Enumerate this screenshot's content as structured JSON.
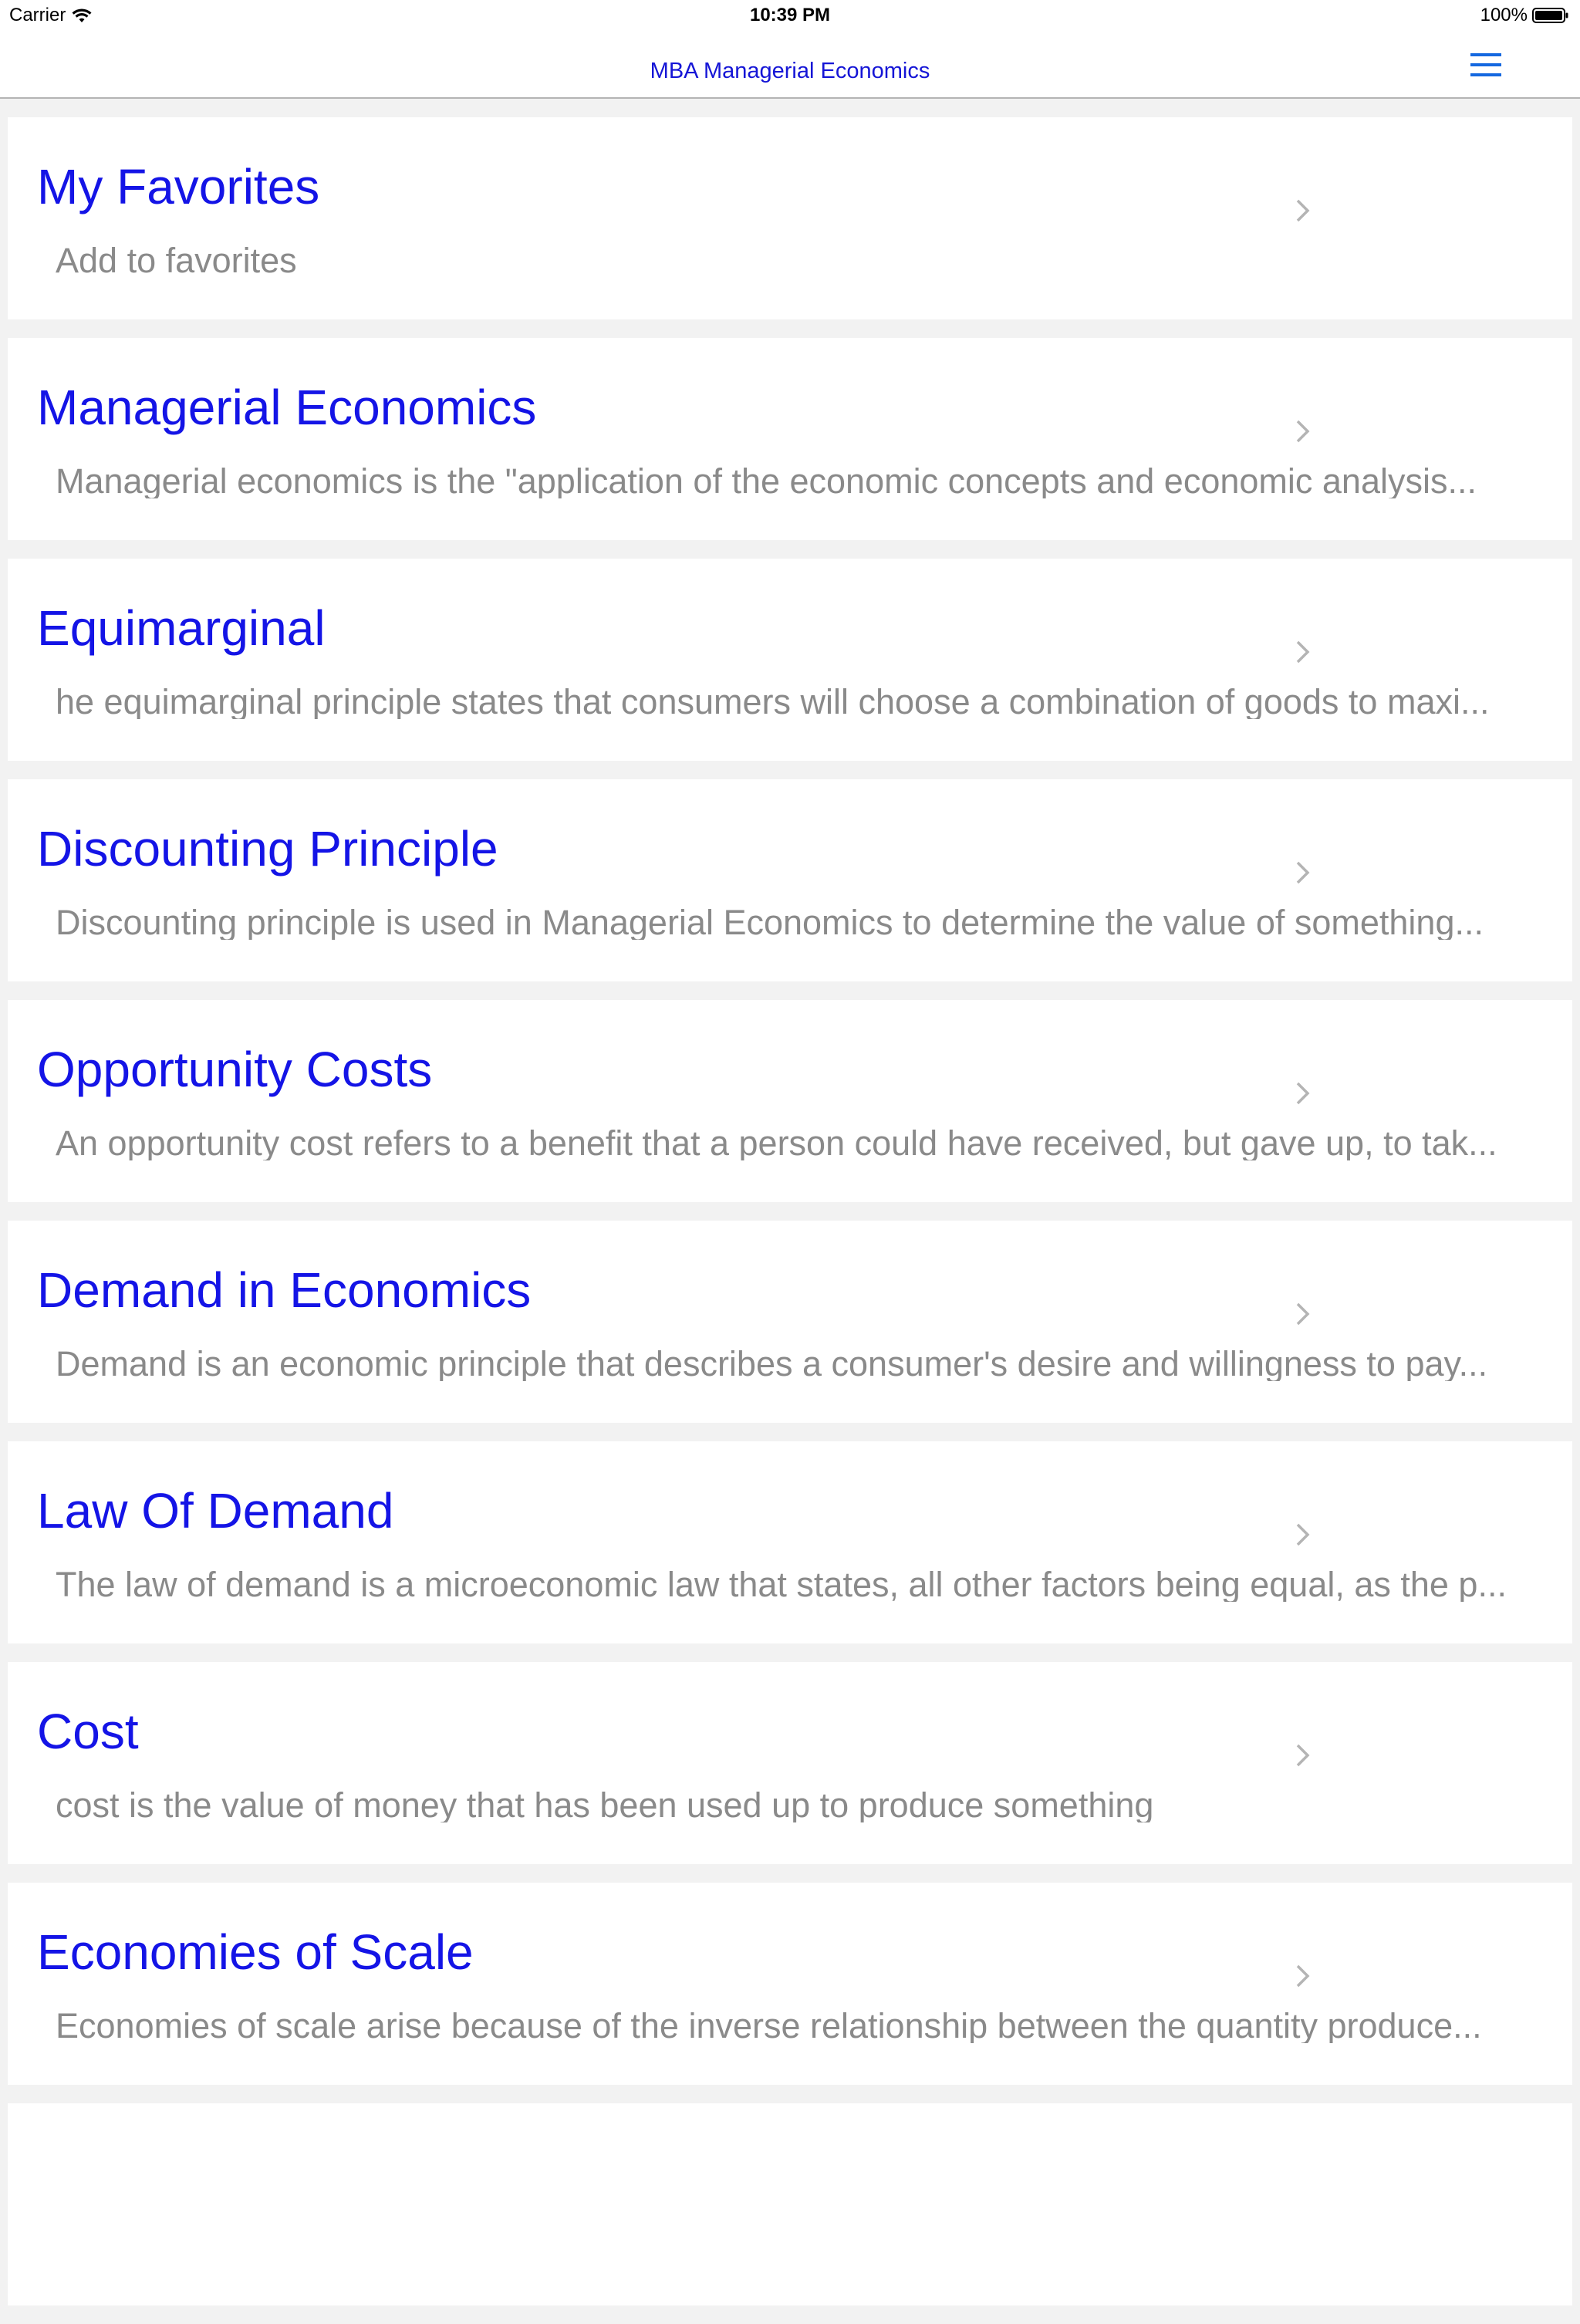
{
  "status_bar": {
    "carrier": "Carrier",
    "time": "10:39 PM",
    "battery": "100%"
  },
  "nav": {
    "title": "MBA Managerial Economics",
    "menu_icon": "hamburger-menu-icon",
    "accent_color": "#1414e6"
  },
  "items": [
    {
      "title": "My Favorites",
      "subtitle": "Add to favorites"
    },
    {
      "title": "Managerial Economics",
      "subtitle": "Managerial economics is the \"application of the economic concepts and economic analysis..."
    },
    {
      "title": "Equimarginal",
      "subtitle": "he equimarginal principle states that consumers will choose a combination of goods to maxi..."
    },
    {
      "title": "Discounting Principle",
      "subtitle": "Discounting principle is used in Managerial Economics to determine the value of something..."
    },
    {
      "title": "Opportunity Costs",
      "subtitle": "An opportunity cost refers to a benefit that a person could have received, but gave up, to tak..."
    },
    {
      "title": "Demand in Economics",
      "subtitle": "Demand is an economic principle that describes a consumer's desire and willingness to pay..."
    },
    {
      "title": "Law Of Demand",
      "subtitle": "The law of demand is a microeconomic law that states, all other factors being equal, as the p..."
    },
    {
      "title": "Cost",
      "subtitle": "cost is the value of money that has been used up to produce something"
    },
    {
      "title": "Economies of Scale",
      "subtitle": "Economies of scale arise because of the inverse relationship between the quantity produce..."
    }
  ]
}
